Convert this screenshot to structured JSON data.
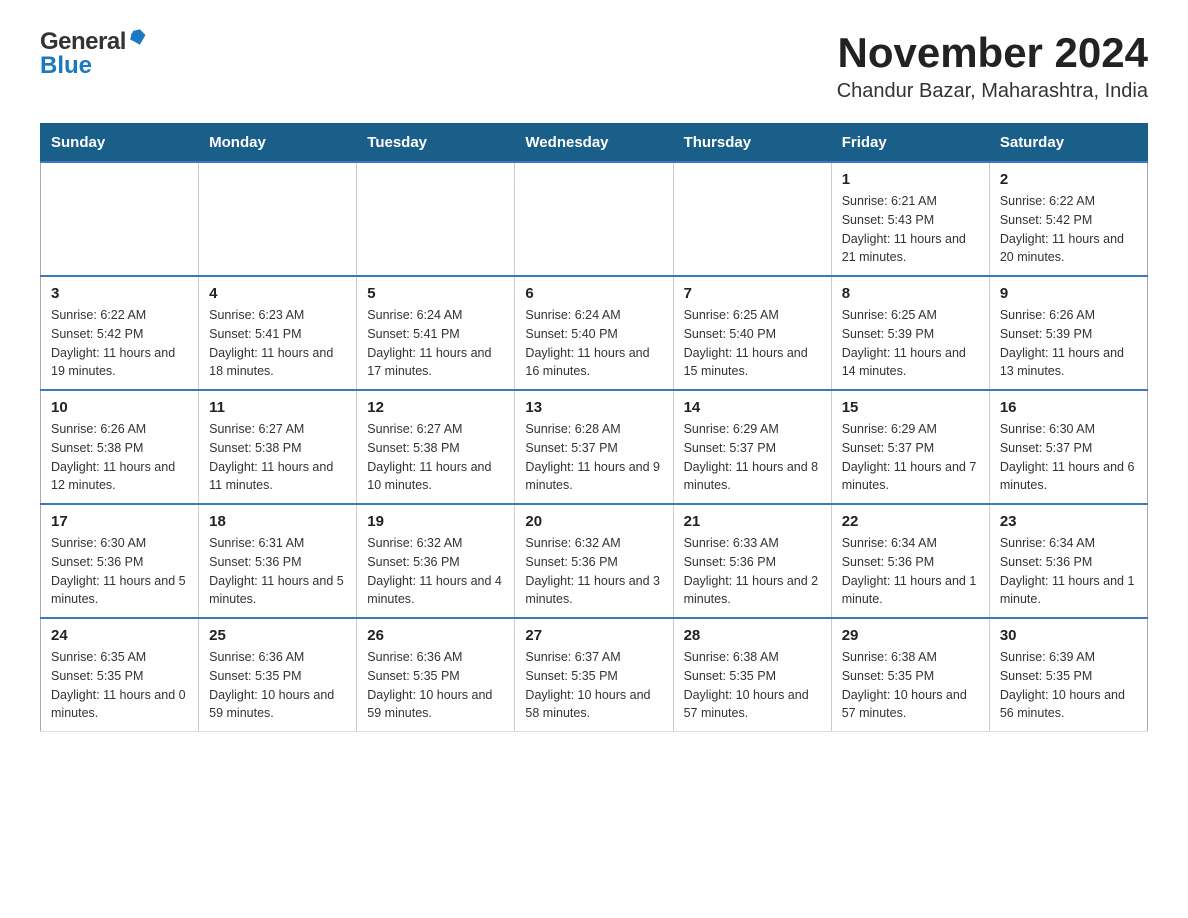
{
  "header": {
    "logo_general": "General",
    "logo_blue": "Blue",
    "title": "November 2024",
    "subtitle": "Chandur Bazar, Maharashtra, India"
  },
  "calendar": {
    "days_of_week": [
      "Sunday",
      "Monday",
      "Tuesday",
      "Wednesday",
      "Thursday",
      "Friday",
      "Saturday"
    ],
    "weeks": [
      [
        {
          "day": "",
          "info": ""
        },
        {
          "day": "",
          "info": ""
        },
        {
          "day": "",
          "info": ""
        },
        {
          "day": "",
          "info": ""
        },
        {
          "day": "",
          "info": ""
        },
        {
          "day": "1",
          "info": "Sunrise: 6:21 AM\nSunset: 5:43 PM\nDaylight: 11 hours and 21 minutes."
        },
        {
          "day": "2",
          "info": "Sunrise: 6:22 AM\nSunset: 5:42 PM\nDaylight: 11 hours and 20 minutes."
        }
      ],
      [
        {
          "day": "3",
          "info": "Sunrise: 6:22 AM\nSunset: 5:42 PM\nDaylight: 11 hours and 19 minutes."
        },
        {
          "day": "4",
          "info": "Sunrise: 6:23 AM\nSunset: 5:41 PM\nDaylight: 11 hours and 18 minutes."
        },
        {
          "day": "5",
          "info": "Sunrise: 6:24 AM\nSunset: 5:41 PM\nDaylight: 11 hours and 17 minutes."
        },
        {
          "day": "6",
          "info": "Sunrise: 6:24 AM\nSunset: 5:40 PM\nDaylight: 11 hours and 16 minutes."
        },
        {
          "day": "7",
          "info": "Sunrise: 6:25 AM\nSunset: 5:40 PM\nDaylight: 11 hours and 15 minutes."
        },
        {
          "day": "8",
          "info": "Sunrise: 6:25 AM\nSunset: 5:39 PM\nDaylight: 11 hours and 14 minutes."
        },
        {
          "day": "9",
          "info": "Sunrise: 6:26 AM\nSunset: 5:39 PM\nDaylight: 11 hours and 13 minutes."
        }
      ],
      [
        {
          "day": "10",
          "info": "Sunrise: 6:26 AM\nSunset: 5:38 PM\nDaylight: 11 hours and 12 minutes."
        },
        {
          "day": "11",
          "info": "Sunrise: 6:27 AM\nSunset: 5:38 PM\nDaylight: 11 hours and 11 minutes."
        },
        {
          "day": "12",
          "info": "Sunrise: 6:27 AM\nSunset: 5:38 PM\nDaylight: 11 hours and 10 minutes."
        },
        {
          "day": "13",
          "info": "Sunrise: 6:28 AM\nSunset: 5:37 PM\nDaylight: 11 hours and 9 minutes."
        },
        {
          "day": "14",
          "info": "Sunrise: 6:29 AM\nSunset: 5:37 PM\nDaylight: 11 hours and 8 minutes."
        },
        {
          "day": "15",
          "info": "Sunrise: 6:29 AM\nSunset: 5:37 PM\nDaylight: 11 hours and 7 minutes."
        },
        {
          "day": "16",
          "info": "Sunrise: 6:30 AM\nSunset: 5:37 PM\nDaylight: 11 hours and 6 minutes."
        }
      ],
      [
        {
          "day": "17",
          "info": "Sunrise: 6:30 AM\nSunset: 5:36 PM\nDaylight: 11 hours and 5 minutes."
        },
        {
          "day": "18",
          "info": "Sunrise: 6:31 AM\nSunset: 5:36 PM\nDaylight: 11 hours and 5 minutes."
        },
        {
          "day": "19",
          "info": "Sunrise: 6:32 AM\nSunset: 5:36 PM\nDaylight: 11 hours and 4 minutes."
        },
        {
          "day": "20",
          "info": "Sunrise: 6:32 AM\nSunset: 5:36 PM\nDaylight: 11 hours and 3 minutes."
        },
        {
          "day": "21",
          "info": "Sunrise: 6:33 AM\nSunset: 5:36 PM\nDaylight: 11 hours and 2 minutes."
        },
        {
          "day": "22",
          "info": "Sunrise: 6:34 AM\nSunset: 5:36 PM\nDaylight: 11 hours and 1 minute."
        },
        {
          "day": "23",
          "info": "Sunrise: 6:34 AM\nSunset: 5:36 PM\nDaylight: 11 hours and 1 minute."
        }
      ],
      [
        {
          "day": "24",
          "info": "Sunrise: 6:35 AM\nSunset: 5:35 PM\nDaylight: 11 hours and 0 minutes."
        },
        {
          "day": "25",
          "info": "Sunrise: 6:36 AM\nSunset: 5:35 PM\nDaylight: 10 hours and 59 minutes."
        },
        {
          "day": "26",
          "info": "Sunrise: 6:36 AM\nSunset: 5:35 PM\nDaylight: 10 hours and 59 minutes."
        },
        {
          "day": "27",
          "info": "Sunrise: 6:37 AM\nSunset: 5:35 PM\nDaylight: 10 hours and 58 minutes."
        },
        {
          "day": "28",
          "info": "Sunrise: 6:38 AM\nSunset: 5:35 PM\nDaylight: 10 hours and 57 minutes."
        },
        {
          "day": "29",
          "info": "Sunrise: 6:38 AM\nSunset: 5:35 PM\nDaylight: 10 hours and 57 minutes."
        },
        {
          "day": "30",
          "info": "Sunrise: 6:39 AM\nSunset: 5:35 PM\nDaylight: 10 hours and 56 minutes."
        }
      ]
    ]
  }
}
